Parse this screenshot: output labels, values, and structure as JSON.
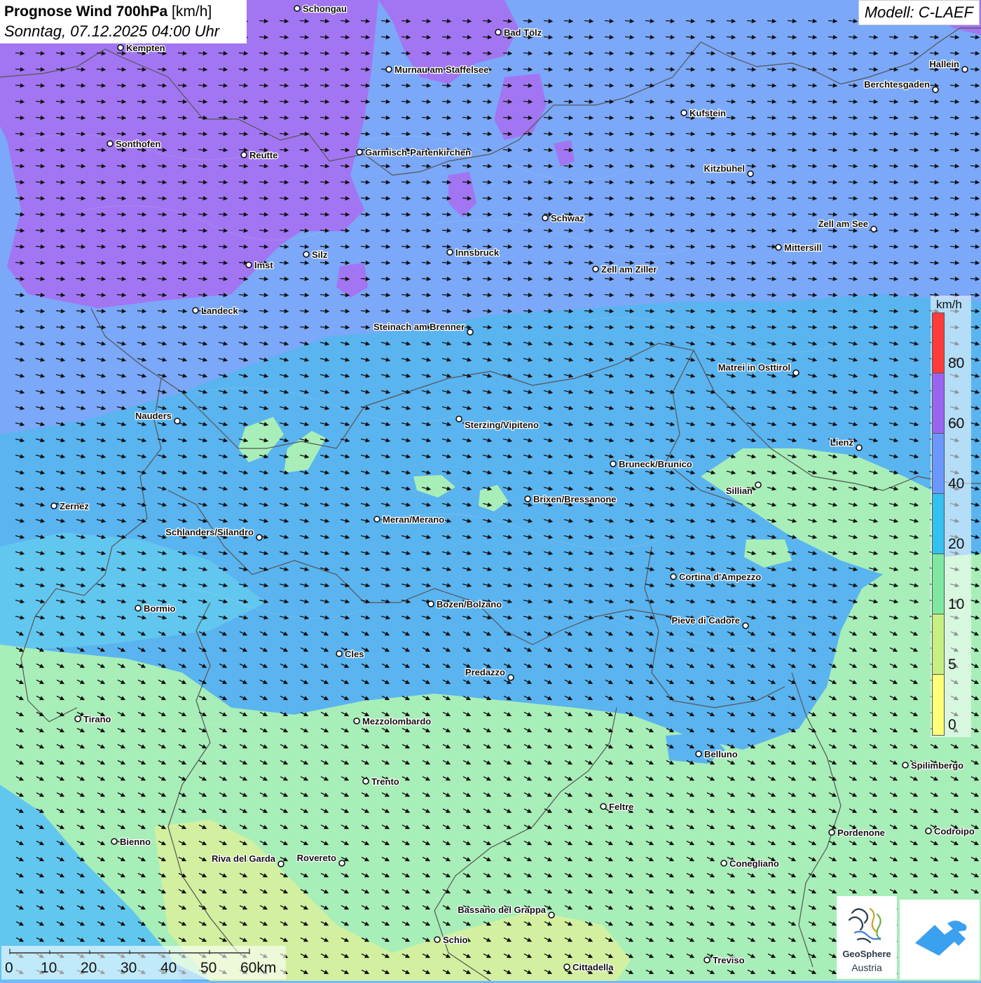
{
  "header": {
    "title_bold": "Prognose Wind 700hPa",
    "title_unit": "[km/h]",
    "subtitle": "Sonntag, 07.12.2025 04:00 Uhr",
    "model": "Modell: C-LAEF"
  },
  "legend": {
    "unit": "km/h",
    "ticks": [
      "80",
      "60",
      "40",
      "20",
      "10",
      "5",
      "0"
    ],
    "colors": [
      "#ff3b3b",
      "#9a64f0",
      "#6a98ff",
      "#34c0f0",
      "#7fe8a0",
      "#c8f080",
      "#ffff78"
    ]
  },
  "scale_bar": {
    "labels": [
      "0",
      "10",
      "20",
      "30",
      "40",
      "50",
      "60km"
    ]
  },
  "branding": {
    "org_name": "GeoSphere",
    "org_country": "Austria"
  },
  "colors": {
    "zone_purple": "#a276f2",
    "zone_blue": "#7ba8f8",
    "zone_cyan": "#5ab4f0",
    "zone_sky": "#62c7ef",
    "zone_green": "#a8eeb8",
    "zone_yellowgreen": "#d2f0a0",
    "arrow": "#111111",
    "border": "#555555"
  },
  "wind": {
    "direction": "west-north-west to east-south-east"
  },
  "cities": [
    {
      "name": "Schongau"
    },
    {
      "name": "Bad Tölz"
    },
    {
      "name": "Kempten"
    },
    {
      "name": "Murnau am Staffelsee"
    },
    {
      "name": "Hallein"
    },
    {
      "name": "Berchtesgaden"
    },
    {
      "name": "Kufstein"
    },
    {
      "name": "Sonthofen"
    },
    {
      "name": "Reutte"
    },
    {
      "name": "Garmisch-Partenkirchen"
    },
    {
      "name": "Kitzbühel"
    },
    {
      "name": "Schwaz"
    },
    {
      "name": "Zell am See"
    },
    {
      "name": "Mittersill"
    },
    {
      "name": "Silz"
    },
    {
      "name": "Innsbruck"
    },
    {
      "name": "Imst"
    },
    {
      "name": "Zell am Ziller"
    },
    {
      "name": "Landeck"
    },
    {
      "name": "Steinach am Brenner"
    },
    {
      "name": "Matrei in Osttirol"
    },
    {
      "name": "Nauders"
    },
    {
      "name": "Sterzing/Vipiteno"
    },
    {
      "name": "Lienz"
    },
    {
      "name": "Bruneck/Brunico"
    },
    {
      "name": "Sillian"
    },
    {
      "name": "Brixen/Bressanone"
    },
    {
      "name": "Zernez"
    },
    {
      "name": "Meran/Merano"
    },
    {
      "name": "Schlanders/Silandro"
    },
    {
      "name": "Cortina d'Ampezzo"
    },
    {
      "name": "Bozen/Bolzano"
    },
    {
      "name": "Bormio"
    },
    {
      "name": "Pieve di Cadore"
    },
    {
      "name": "Cles"
    },
    {
      "name": "Predazzo"
    },
    {
      "name": "Tirano"
    },
    {
      "name": "Mezzolombardo"
    },
    {
      "name": "Belluno"
    },
    {
      "name": "Spilimbergo"
    },
    {
      "name": "Trento"
    },
    {
      "name": "Feltre"
    },
    {
      "name": "Pordenone"
    },
    {
      "name": "Codroipo"
    },
    {
      "name": "Bienno"
    },
    {
      "name": "Riva del Garda"
    },
    {
      "name": "Rovereto"
    },
    {
      "name": "Conegliano"
    },
    {
      "name": "Bassano del Grappa"
    },
    {
      "name": "Schio"
    },
    {
      "name": "Treviso"
    },
    {
      "name": "Cittadella"
    }
  ]
}
